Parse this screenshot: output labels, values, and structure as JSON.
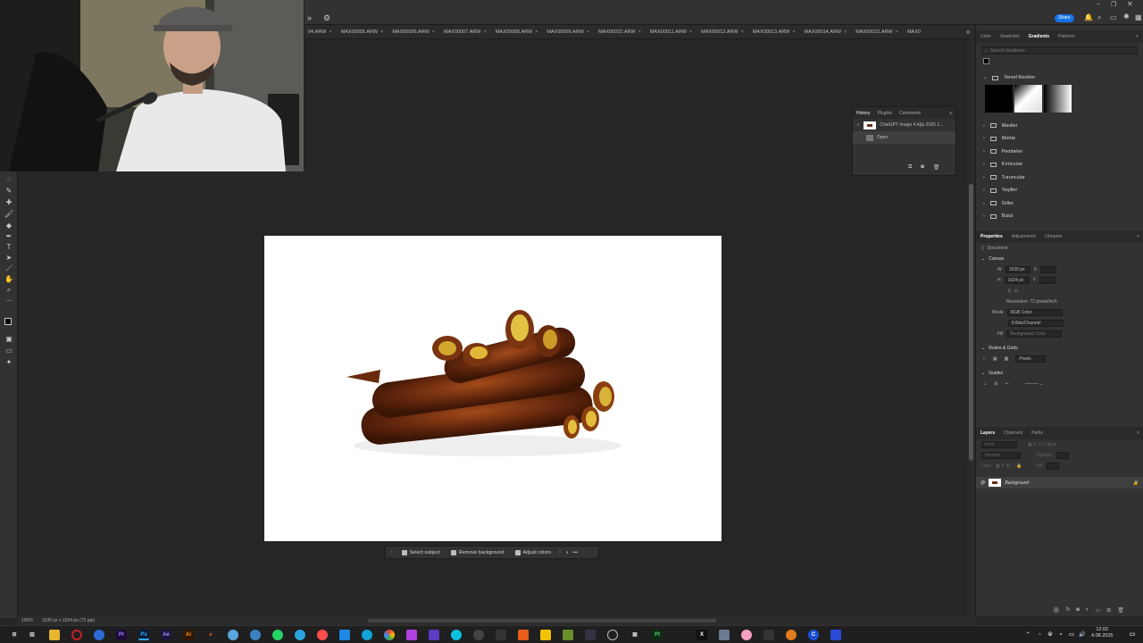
{
  "doc_tabs": [
    "04.ARW",
    "MAX00005.ARW",
    "MAX00006.ARW",
    "MAX00007.ARW",
    "MAX00008.ARW",
    "MAX00009.ARW",
    "MAX00010.ARW",
    "MAX00011.ARW",
    "MAX00012.ARW",
    "MAX00013.ARW",
    "MAX00014.ARW",
    "MAX00015.ARW",
    "MAX0"
  ],
  "topbar": {
    "share_label": "Share"
  },
  "history_panel": {
    "tabs": [
      "History",
      "Plugins",
      "Comments"
    ],
    "snapshot_label": "ChatGPT Image 4 Ağu 2025 1...",
    "step_label": "Open"
  },
  "gradients_panel": {
    "tabs": [
      "Color",
      "Swatches",
      "Gradients",
      "Patterns"
    ],
    "search_placeholder": "Search Gradients",
    "groups": [
      "Temel Renkler",
      "Maviler",
      "Morlar",
      "Pembeler",
      "Kırmızılar",
      "Turuncular",
      "Yeşiller",
      "Griler",
      "Bulut"
    ]
  },
  "properties_panel": {
    "tabs": [
      "Properties",
      "Adjustments",
      "Libraries"
    ],
    "doc_label": "Document",
    "canvas_label": "Canvas",
    "width": "1536 px",
    "height": "1024 px",
    "resolution": "Resolution: 72 pixels/inch",
    "mode_label": "Mode",
    "mode_value": "RGB Color",
    "bit_depth": "8 Bits/Channel",
    "fill_label": "Fill",
    "fill_value": "Background Color",
    "rulers_label": "Rulers & Grids",
    "units_value": "Pixels",
    "guides_label": "Guides"
  },
  "layers_panel": {
    "tabs": [
      "Layers",
      "Channels",
      "Paths"
    ],
    "kind_placeholder": "Kind",
    "blend_mode": "Normal",
    "opacity_label": "Opacity:",
    "lock_label": "Lock:",
    "fill_label": "Fill:",
    "layer_name": "Background"
  },
  "context_bar": {
    "select_subject": "Select subject",
    "remove_background": "Remove background",
    "adjust_colors": "Adjust colors"
  },
  "status": {
    "zoom": "100%",
    "doc_size": "1536 px x 1024 px (72 ppi)"
  },
  "clock": {
    "time": "12:02",
    "date": "4.08.2025"
  },
  "taskbar_icons": [
    "Ps",
    "Ae",
    "Ai",
    "Pr",
    "Pt",
    "X",
    "C"
  ]
}
